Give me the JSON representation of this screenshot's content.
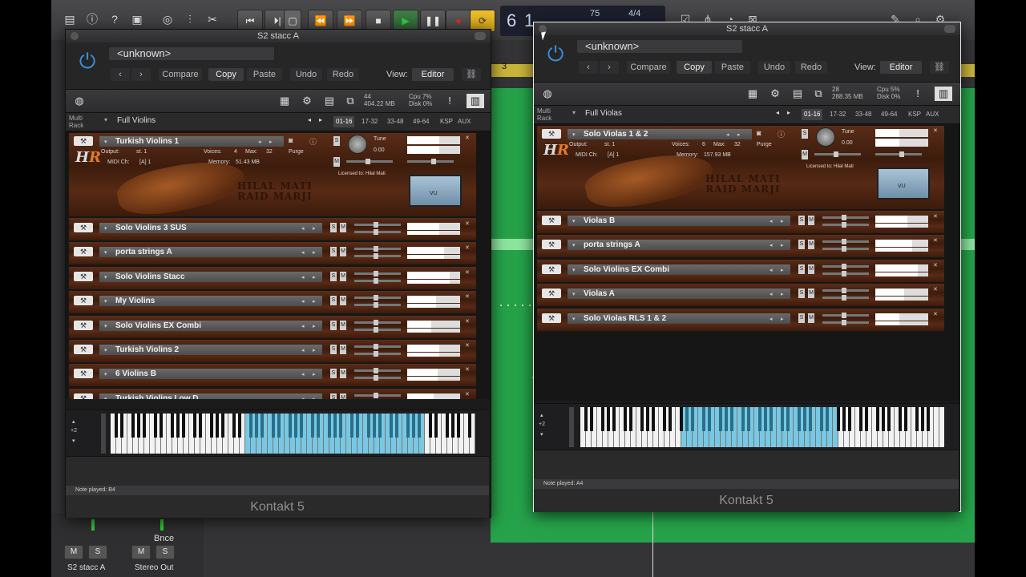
{
  "toolbar": {
    "icons": [
      "library-icon",
      "info-icon",
      "help-icon",
      "editor-icon",
      "smart-controls-icon",
      "mixer-icon",
      "scissors-icon"
    ],
    "transport": [
      "rewind-to-start",
      "play-from-selection",
      "record-area",
      "rewind",
      "fast-forward",
      "stop",
      "play",
      "pause",
      "record",
      "cycle"
    ],
    "lcd": {
      "bar": "6",
      "beat": "1",
      "tempo": "75",
      "signature": "4/4"
    }
  },
  "mixer": {
    "strip1": {
      "name": "S2 stacc A",
      "mute": "M",
      "solo": "S"
    },
    "strip2": {
      "name": "Stereo Out",
      "mute": "M",
      "solo": "S",
      "bounce": "Bnce"
    }
  },
  "ruler": {
    "marker": "3"
  },
  "left": {
    "title": "S2 stacc A",
    "preset": "<unknown>",
    "compare": "Compare",
    "copy": "Copy",
    "paste": "Paste",
    "undo": "Undo",
    "redo": "Redo",
    "view_label": "View:",
    "view_value": "Editor",
    "stats": {
      "voices": "44",
      "mem": "404.22 MB",
      "cpu": "7%",
      "disk": "0%",
      "cpu_label": "Cpu",
      "disk_label": "Disk"
    },
    "multi_label": "Multi\nRack",
    "rack_name": "Full Violins",
    "pages": [
      "01-16",
      "17-32",
      "33-48",
      "49-64",
      "KSP",
      "AUX"
    ],
    "main": {
      "name": "Turkish Violins 1",
      "output_label": "Output:",
      "output": "st. 1",
      "voices_label": "Voices:",
      "voices": "4",
      "max_label": "Max:",
      "max": "32",
      "purge": "Purge",
      "midi_label": "MIDI Ch:",
      "midi": "[A] 1",
      "memory_label": "Memory:",
      "memory": "51.43 MB",
      "tune_label": "Tune",
      "tune": "0.00",
      "licensed": "Licensed to: Hilal Mati",
      "wm1": "HILAL MATI",
      "wm2": "RAID MARJI",
      "logo": "HR"
    },
    "rows": [
      "Solo Violins 3 SUS",
      "porta strings A",
      "Solo Violins Stacc",
      "My Violins",
      "Solo Violins EX Combi",
      "Turkish Violins 2",
      "6 Violins B",
      "Turkish Violins Low D"
    ],
    "octave": "+2",
    "note_played": "Note played: B4",
    "brand": "Kontakt 5"
  },
  "right": {
    "title": "S2 stacc A",
    "preset": "<unknown>",
    "compare": "Compare",
    "copy": "Copy",
    "paste": "Paste",
    "undo": "Undo",
    "redo": "Redo",
    "view_label": "View:",
    "view_value": "Editor",
    "stats": {
      "voices": "28",
      "mem": "288.35 MB",
      "cpu": "5%",
      "disk": "0%",
      "cpu_label": "Cpu",
      "disk_label": "Disk"
    },
    "multi_label": "Multi\nRack",
    "rack_name": "Full Violas",
    "pages": [
      "01-16",
      "17-32",
      "33-48",
      "49-64",
      "KSP",
      "AUX"
    ],
    "main": {
      "name": "Solo Violas 1 & 2",
      "output_label": "Output:",
      "output": "st. 1",
      "voices_label": "Voices:",
      "voices": "6",
      "max_label": "Max:",
      "max": "32",
      "purge": "Purge",
      "midi_label": "MIDI Ch:",
      "midi": "[A] 1",
      "memory_label": "Memory:",
      "memory": "157.93 MB",
      "tune_label": "Tune",
      "tune": "0.00",
      "licensed": "Licensed to: Hilal Mati",
      "wm1": "HILAL MATI",
      "wm2": "RAID MARJI",
      "logo": "HR"
    },
    "rows": [
      "Violas B",
      "porta strings A",
      "Solo Violins EX Combi",
      "Violas A",
      "Solo Violas RLS 1 & 2"
    ],
    "octave": "+2",
    "note_played": "Note played: A4",
    "brand": "Kontakt 5"
  }
}
